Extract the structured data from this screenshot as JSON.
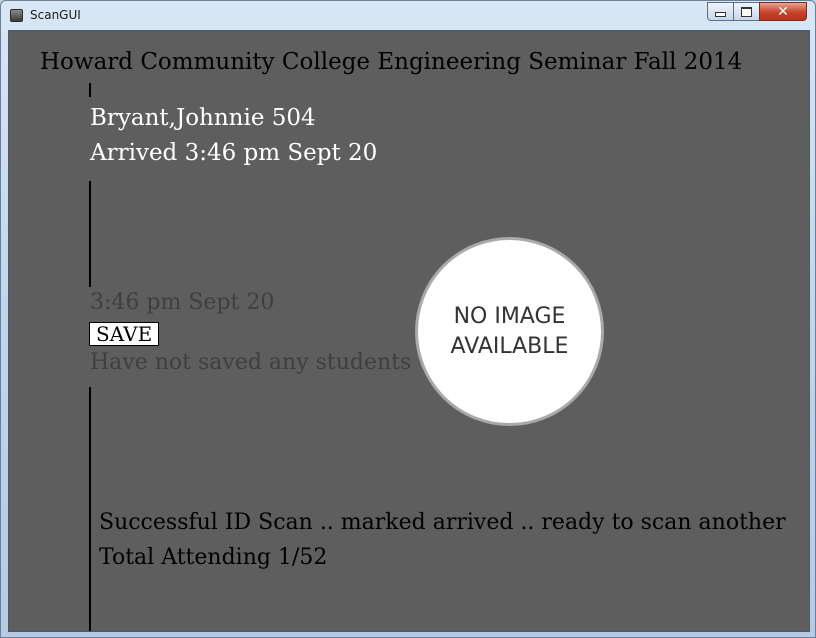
{
  "window": {
    "title": "ScanGUI",
    "minimize_glyph": "minimize-icon",
    "maximize_glyph": "maximize-icon",
    "close_glyph": "✕"
  },
  "header": {
    "title": "Howard Community College Engineering Seminar Fall 2014"
  },
  "student": {
    "name": "Bryant,Johnnie 504",
    "arrival": "Arrived 3:46 pm Sept 20"
  },
  "photo": {
    "placeholder_text": "NO IMAGE\nAVAILABLE"
  },
  "clock": {
    "time": "3:46 pm Sept 20"
  },
  "save": {
    "label": "SAVE",
    "status": "Have not saved any students"
  },
  "scan": {
    "message": "Successful ID Scan .. marked arrived .. ready to scan another",
    "total": "Total Attending 1/52"
  },
  "colors": {
    "background": "#5e5e5e",
    "primary_text": "#ffffff",
    "muted_text": "#3f3f3f",
    "close_button": "#c7432a"
  }
}
